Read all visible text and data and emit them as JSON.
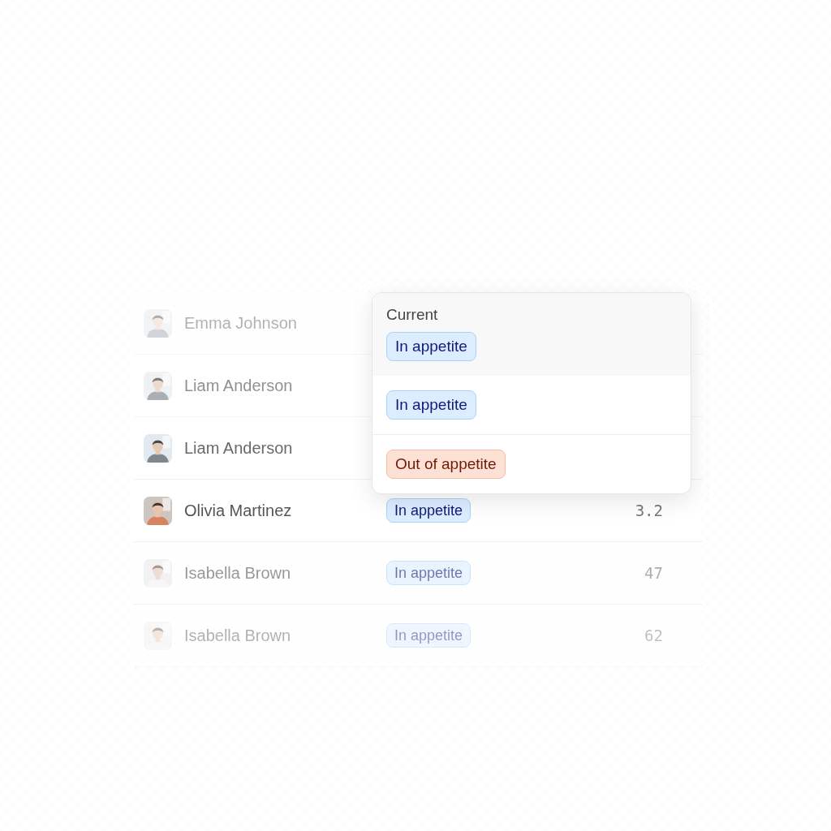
{
  "table": {
    "rows": [
      {
        "name": "Emma Johnson"
      },
      {
        "name": "Liam Anderson"
      },
      {
        "name": "Liam Anderson"
      },
      {
        "name": "Olivia Martinez",
        "status": {
          "label": "In appetite",
          "kind": "in"
        },
        "value": "3.2"
      },
      {
        "name": "Isabella Brown",
        "status": {
          "label": "In appetite",
          "kind": "in"
        },
        "value": "47"
      },
      {
        "name": "Isabella Brown",
        "status": {
          "label": "In appetite",
          "kind": "in"
        },
        "value": "62"
      }
    ]
  },
  "status_menu": {
    "heading": "Current",
    "current": {
      "label": "In appetite",
      "kind": "in"
    },
    "options": [
      {
        "label": "In appetite",
        "kind": "in"
      },
      {
        "label": "Out of appetite",
        "kind": "out"
      }
    ]
  }
}
